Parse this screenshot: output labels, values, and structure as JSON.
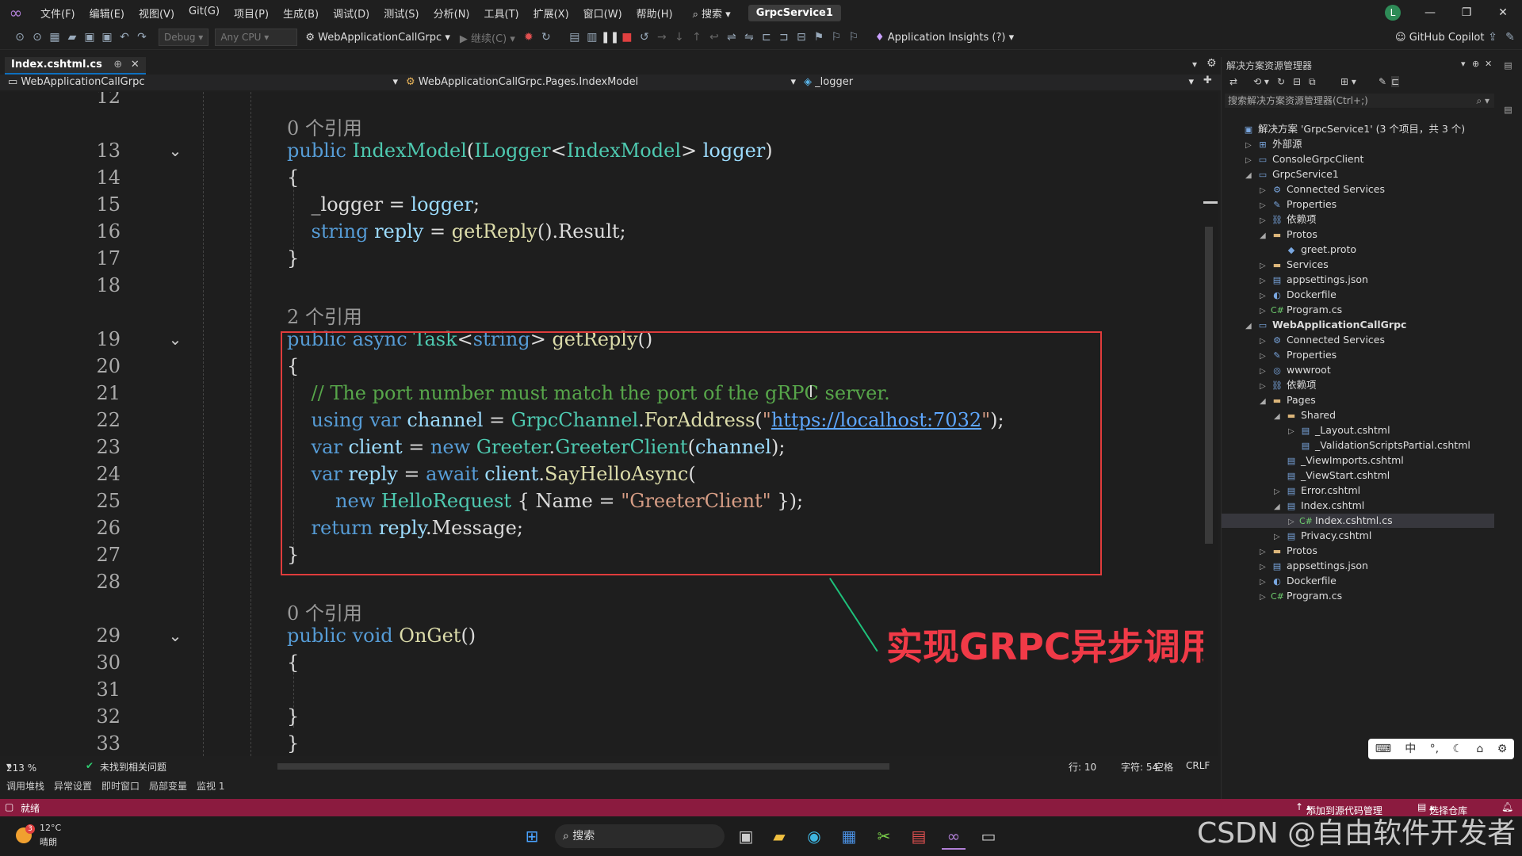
{
  "titlebar": {
    "menu": [
      "文件(F)",
      "编辑(E)",
      "视图(V)",
      "Git(G)",
      "项目(P)",
      "生成(B)",
      "调试(D)",
      "测试(S)",
      "分析(N)",
      "工具(T)",
      "扩展(X)",
      "窗口(W)",
      "帮助(H)"
    ],
    "search": "搜索",
    "solution_name": "GrpcService1",
    "avatar_letter": "L"
  },
  "toolbar": {
    "config": "Debug",
    "platform": "Any CPU",
    "startup_project": "WebApplicationCallGrpc",
    "continue_label": "继续(C)",
    "app_insights": "Application Insights (?)",
    "copilot": "GitHub Copilot"
  },
  "tabs": {
    "active": "Index.cshtml.cs"
  },
  "navbar": {
    "project": "WebApplicationCallGrpc",
    "class": "WebApplicationCallGrpc.Pages.IndexModel",
    "member": "_logger"
  },
  "code_lines": [
    {
      "n": "12",
      "parts": [],
      "refs": ""
    },
    {
      "n": "",
      "parts": [],
      "refs": "0 个引用"
    },
    {
      "n": "13",
      "parts": [
        [
          "kw",
          "public "
        ],
        [
          "ty",
          "IndexModel"
        ],
        [
          "",
          "("
        ],
        [
          "ty",
          "ILogger"
        ],
        [
          "",
          "<"
        ],
        [
          "ty",
          "IndexModel"
        ],
        [
          "",
          "> "
        ],
        [
          "pa",
          "logger"
        ],
        [
          "",
          ")"
        ]
      ],
      "refs": ""
    },
    {
      "n": "14",
      "parts": [
        [
          "",
          "{"
        ]
      ],
      "refs": ""
    },
    {
      "n": "15",
      "parts": [
        [
          "",
          "    _logger = "
        ],
        [
          "pa",
          "logger"
        ],
        [
          "",
          ";"
        ]
      ],
      "refs": ""
    },
    {
      "n": "16",
      "parts": [
        [
          "kw",
          "    string "
        ],
        [
          "pa",
          "reply"
        ],
        [
          "",
          " = "
        ],
        [
          "fn",
          "getReply"
        ],
        [
          "",
          "().Result;"
        ]
      ],
      "refs": ""
    },
    {
      "n": "17",
      "parts": [
        [
          "",
          "}"
        ]
      ],
      "refs": ""
    },
    {
      "n": "18",
      "parts": [],
      "refs": ""
    },
    {
      "n": "",
      "parts": [],
      "refs": "2 个引用"
    },
    {
      "n": "19",
      "parts": [
        [
          "kw",
          "public async "
        ],
        [
          "ty",
          "Task"
        ],
        [
          "",
          "<"
        ],
        [
          "kw",
          "string"
        ],
        [
          "",
          "> "
        ],
        [
          "fn",
          "getReply"
        ],
        [
          "",
          "()"
        ]
      ],
      "refs": ""
    },
    {
      "n": "20",
      "parts": [
        [
          "",
          "{"
        ]
      ],
      "refs": ""
    },
    {
      "n": "21",
      "parts": [
        [
          "cm",
          "    // The port number must match the port of the gRPC server."
        ]
      ],
      "refs": ""
    },
    {
      "n": "22",
      "parts": [
        [
          "kw",
          "    using var "
        ],
        [
          "pa",
          "channel"
        ],
        [
          "",
          " = "
        ],
        [
          "ty",
          "GrpcChannel"
        ],
        [
          "",
          "."
        ],
        [
          "fn",
          "ForAddress"
        ],
        [
          "",
          "("
        ],
        [
          "st",
          "\""
        ],
        [
          "url",
          "https://localhost:7032"
        ],
        [
          "st",
          "\""
        ],
        [
          "",
          ");"
        ]
      ],
      "refs": ""
    },
    {
      "n": "23",
      "parts": [
        [
          "kw",
          "    var "
        ],
        [
          "pa",
          "client"
        ],
        [
          "",
          " = "
        ],
        [
          "kw",
          "new "
        ],
        [
          "ty",
          "Greeter"
        ],
        [
          "",
          "."
        ],
        [
          "ty",
          "GreeterClient"
        ],
        [
          "",
          "("
        ],
        [
          "pa",
          "channel"
        ],
        [
          "",
          ");"
        ]
      ],
      "refs": ""
    },
    {
      "n": "24",
      "parts": [
        [
          "kw",
          "    var "
        ],
        [
          "pa",
          "reply"
        ],
        [
          "",
          " = "
        ],
        [
          "kw",
          "await "
        ],
        [
          "pa",
          "client"
        ],
        [
          "",
          "."
        ],
        [
          "fn",
          "SayHelloAsync"
        ],
        [
          "",
          "("
        ]
      ],
      "refs": ""
    },
    {
      "n": "25",
      "parts": [
        [
          "kw",
          "        new "
        ],
        [
          "ty",
          "HelloRequest"
        ],
        [
          "",
          " { Name = "
        ],
        [
          "st",
          "\"GreeterClient\""
        ],
        [
          "",
          " });"
        ]
      ],
      "refs": ""
    },
    {
      "n": "26",
      "parts": [
        [
          "kw",
          "    return "
        ],
        [
          "pa",
          "reply"
        ],
        [
          "",
          ".Message;"
        ]
      ],
      "refs": ""
    },
    {
      "n": "27",
      "parts": [
        [
          "",
          "}"
        ]
      ],
      "refs": ""
    },
    {
      "n": "28",
      "parts": [],
      "refs": ""
    },
    {
      "n": "",
      "parts": [],
      "refs": "0 个引用"
    },
    {
      "n": "29",
      "parts": [
        [
          "kw",
          "public void "
        ],
        [
          "fn",
          "OnGet"
        ],
        [
          "",
          "()"
        ]
      ],
      "refs": ""
    },
    {
      "n": "30",
      "parts": [
        [
          "",
          "{"
        ]
      ],
      "refs": ""
    },
    {
      "n": "31",
      "parts": [],
      "refs": ""
    },
    {
      "n": "32",
      "parts": [
        [
          "",
          "}"
        ]
      ],
      "refs": ""
    },
    {
      "n": "33",
      "parts": [
        [
          "",
          "}"
        ]
      ],
      "refs": ""
    }
  ],
  "annotation": "实现GRPC异步调用",
  "editor_status": {
    "zoom": "213 %",
    "issues": "未找到相关问题",
    "line": "行: 10",
    "char": "字符: 54",
    "spaces": "空格",
    "eol": "CRLF"
  },
  "bottom_tabs": [
    "调用堆栈",
    "异常设置",
    "即时窗口",
    "局部变量",
    "监视 1"
  ],
  "statusbar": {
    "ready": "就绪",
    "add_source": "添加到源代码管理",
    "select_repo": "选择仓库"
  },
  "solution_explorer": {
    "title": "解决方案资源管理器",
    "search_placeholder": "搜索解决方案资源管理器(Ctrl+;)",
    "items": [
      {
        "label": "解决方案 'GrpcService1' (3 个项目，共 3 个)",
        "level": 0,
        "arrow": "",
        "icon": "▣",
        "bold": false
      },
      {
        "label": "外部源",
        "level": 1,
        "arrow": "▷",
        "icon": "⊞",
        "bold": false
      },
      {
        "label": "ConsoleGrpcClient",
        "level": 1,
        "arrow": "▷",
        "icon": "▭",
        "bold": false
      },
      {
        "label": "GrpcService1",
        "level": 1,
        "arrow": "◢",
        "icon": "▭",
        "bold": false
      },
      {
        "label": "Connected Services",
        "level": 2,
        "arrow": "▷",
        "icon": "⚙",
        "bold": false
      },
      {
        "label": "Properties",
        "level": 2,
        "arrow": "▷",
        "icon": "✎",
        "bold": false
      },
      {
        "label": "依赖项",
        "level": 2,
        "arrow": "▷",
        "icon": "⛓",
        "bold": false
      },
      {
        "label": "Protos",
        "level": 2,
        "arrow": "◢",
        "icon": "▬",
        "bold": false
      },
      {
        "label": "greet.proto",
        "level": 3,
        "arrow": "",
        "icon": "◆",
        "bold": false
      },
      {
        "label": "Services",
        "level": 2,
        "arrow": "▷",
        "icon": "▬",
        "bold": false
      },
      {
        "label": "appsettings.json",
        "level": 2,
        "arrow": "▷",
        "icon": "▤",
        "bold": false
      },
      {
        "label": "Dockerfile",
        "level": 2,
        "arrow": "▷",
        "icon": "◐",
        "bold": false
      },
      {
        "label": "Program.cs",
        "level": 2,
        "arrow": "▷",
        "icon": "C#",
        "bold": false
      },
      {
        "label": "WebApplicationCallGrpc",
        "level": 1,
        "arrow": "◢",
        "icon": "▭",
        "bold": true
      },
      {
        "label": "Connected Services",
        "level": 2,
        "arrow": "▷",
        "icon": "⚙",
        "bold": false
      },
      {
        "label": "Properties",
        "level": 2,
        "arrow": "▷",
        "icon": "✎",
        "bold": false
      },
      {
        "label": "wwwroot",
        "level": 2,
        "arrow": "▷",
        "icon": "◎",
        "bold": false
      },
      {
        "label": "依赖项",
        "level": 2,
        "arrow": "▷",
        "icon": "⛓",
        "bold": false
      },
      {
        "label": "Pages",
        "level": 2,
        "arrow": "◢",
        "icon": "▬",
        "bold": false
      },
      {
        "label": "Shared",
        "level": 3,
        "arrow": "◢",
        "icon": "▬",
        "bold": false
      },
      {
        "label": "_Layout.cshtml",
        "level": 4,
        "arrow": "▷",
        "icon": "▤",
        "bold": false
      },
      {
        "label": "_ValidationScriptsPartial.cshtml",
        "level": 4,
        "arrow": "",
        "icon": "▤",
        "bold": false
      },
      {
        "label": "_ViewImports.cshtml",
        "level": 3,
        "arrow": "",
        "icon": "▤",
        "bold": false
      },
      {
        "label": "_ViewStart.cshtml",
        "level": 3,
        "arrow": "",
        "icon": "▤",
        "bold": false
      },
      {
        "label": "Error.cshtml",
        "level": 3,
        "arrow": "▷",
        "icon": "▤",
        "bold": false
      },
      {
        "label": "Index.cshtml",
        "level": 3,
        "arrow": "◢",
        "icon": "▤",
        "bold": false
      },
      {
        "label": "Index.cshtml.cs",
        "level": 4,
        "arrow": "▷",
        "icon": "C#",
        "bold": false,
        "selected": true
      },
      {
        "label": "Privacy.cshtml",
        "level": 3,
        "arrow": "▷",
        "icon": "▤",
        "bold": false
      },
      {
        "label": "Protos",
        "level": 2,
        "arrow": "▷",
        "icon": "▬",
        "bold": false
      },
      {
        "label": "appsettings.json",
        "level": 2,
        "arrow": "▷",
        "icon": "▤",
        "bold": false
      },
      {
        "label": "Dockerfile",
        "level": 2,
        "arrow": "▷",
        "icon": "◐",
        "bold": false
      },
      {
        "label": "Program.cs",
        "level": 2,
        "arrow": "▷",
        "icon": "C#",
        "bold": false
      }
    ]
  },
  "taskbar": {
    "weather_temp": "12°C",
    "weather_desc": "晴朗",
    "weather_badge": "3",
    "search": "搜索"
  },
  "ime": [
    "中",
    "°,",
    "☾"
  ],
  "watermark": "CSDN @自由软件开发者",
  "colors": {
    "accent": "#0e70c0",
    "statusbar": "#8b1b3f",
    "highlight_box": "#e03c3c",
    "annotation": "#f03a47"
  }
}
